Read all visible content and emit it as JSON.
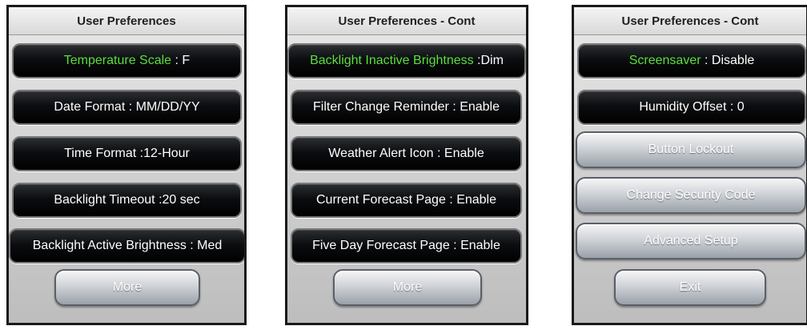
{
  "panels": [
    {
      "title": "User Preferences",
      "rows": [
        {
          "label": "Temperature Scale",
          "sep": " : ",
          "value": "F"
        },
        {
          "label": "Date Format",
          "sep": " : ",
          "value": "MM/DD/YY"
        },
        {
          "label": "Time Format",
          "sep": " :",
          "value": "12-Hour"
        },
        {
          "label": "Backlight Timeout",
          "sep": " :",
          "value": "20 sec"
        },
        {
          "label": "Backlight Active Brightness",
          "sep": " : ",
          "value": "Med"
        }
      ],
      "more_label": "More"
    },
    {
      "title": "User Preferences - Cont",
      "rows": [
        {
          "label": "Backlight Inactive Brightness",
          "sep": " :",
          "value": "Dim"
        },
        {
          "label": "Filter Change Reminder",
          "sep": " : ",
          "value": "Enable"
        },
        {
          "label": "Weather Alert Icon",
          "sep": " : ",
          "value": "Enable"
        },
        {
          "label": "Current Forecast Page",
          "sep": " : ",
          "value": "Enable"
        },
        {
          "label": "Five Day Forecast Page",
          "sep": " : ",
          "value": "Enable"
        }
      ],
      "more_label": "More"
    },
    {
      "title": "User Preferences - Cont",
      "rows": [
        {
          "label": "Screensaver",
          "sep": " : ",
          "value": "Disable"
        },
        {
          "label": "Humidity Offset",
          "sep": " : ",
          "value": "0"
        }
      ],
      "buttons": [
        "Button Lockout",
        "Change Security Code",
        "Advanced Setup"
      ],
      "exit_label": "Exit"
    }
  ],
  "colors": {
    "highlight": "#5cde3c",
    "text": "#ffffff"
  }
}
